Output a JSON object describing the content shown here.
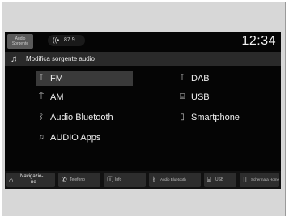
{
  "status_bar": {
    "source_label": "Audio Sorgente",
    "station_icon": "radio-wave-icon",
    "station_text": "87.9",
    "clock": "12:34"
  },
  "header": {
    "icon": "music-note-icon",
    "title": "Modifica sorgente audio"
  },
  "options": [
    {
      "id": "fm",
      "icon": "radio-antenna-icon",
      "label": "FM",
      "selected": true
    },
    {
      "id": "dab",
      "icon": "radio-antenna-icon",
      "label": "DAB",
      "selected": false
    },
    {
      "id": "am",
      "icon": "radio-antenna-icon",
      "label": "AM",
      "selected": false
    },
    {
      "id": "usb",
      "icon": "usb-icon",
      "label": "USB",
      "selected": false
    },
    {
      "id": "bluetooth",
      "icon": "bluetooth-icon",
      "label": "Audio Bluetooth",
      "selected": false
    },
    {
      "id": "smartphone",
      "icon": "smartphone-icon",
      "label": "Smartphone",
      "selected": false
    },
    {
      "id": "apps",
      "icon": "music-note-icon",
      "label": "AUDIO Apps",
      "selected": false
    }
  ],
  "bottom_bar": {
    "navigation": {
      "line1": "Navigazio-",
      "line2": "ne",
      "icon": "home-icon"
    },
    "buttons": [
      {
        "id": "phone",
        "icon": "phone-icon",
        "label": "Telefono"
      },
      {
        "id": "info",
        "icon": "info-icon",
        "label": "Info"
      },
      {
        "id": "audio-bt",
        "icon": "bluetooth-icon",
        "label": "Audio Bluetooth"
      },
      {
        "id": "usb",
        "icon": "usb-icon",
        "label": "USB"
      },
      {
        "id": "home",
        "icon": "grid-icon",
        "label": "Schermata Home"
      }
    ]
  }
}
